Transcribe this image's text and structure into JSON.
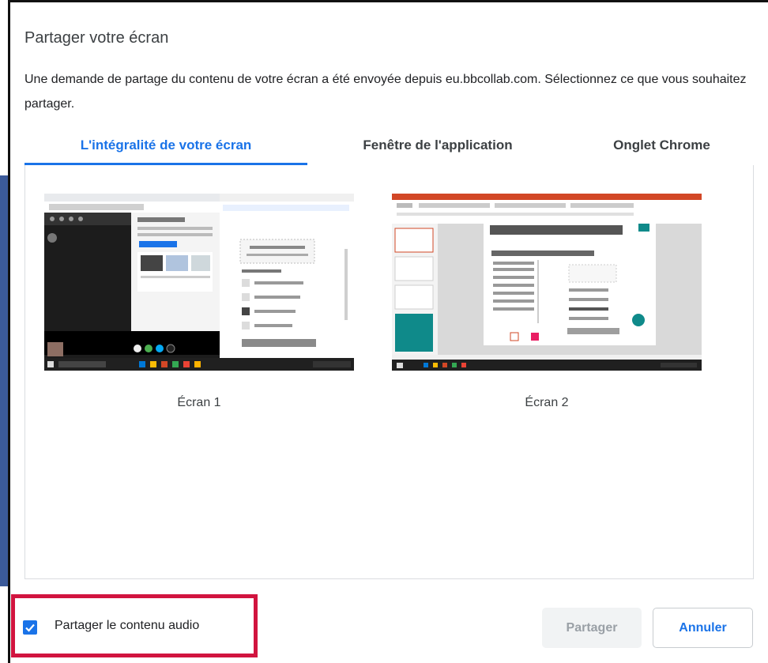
{
  "dialog": {
    "title": "Partager votre écran",
    "description": "Une demande de partage du contenu de votre écran a été envoyée depuis eu.bbcollab.com. Sélectionnez ce que vous souhaitez partager."
  },
  "tabs": [
    {
      "label": "L'intégralité de votre écran",
      "active": true
    },
    {
      "label": "Fenêtre de l'application",
      "active": false
    },
    {
      "label": "Onglet Chrome",
      "active": false
    }
  ],
  "screens": [
    {
      "label": "Écran 1"
    },
    {
      "label": "Écran 2"
    }
  ],
  "audio": {
    "label": "Partager le contenu audio",
    "checked": true
  },
  "buttons": {
    "share": "Partager",
    "cancel": "Annuler"
  },
  "colors": {
    "accent": "#1a73e8",
    "highlight": "#d1143f",
    "ppt_red": "#d24726"
  }
}
